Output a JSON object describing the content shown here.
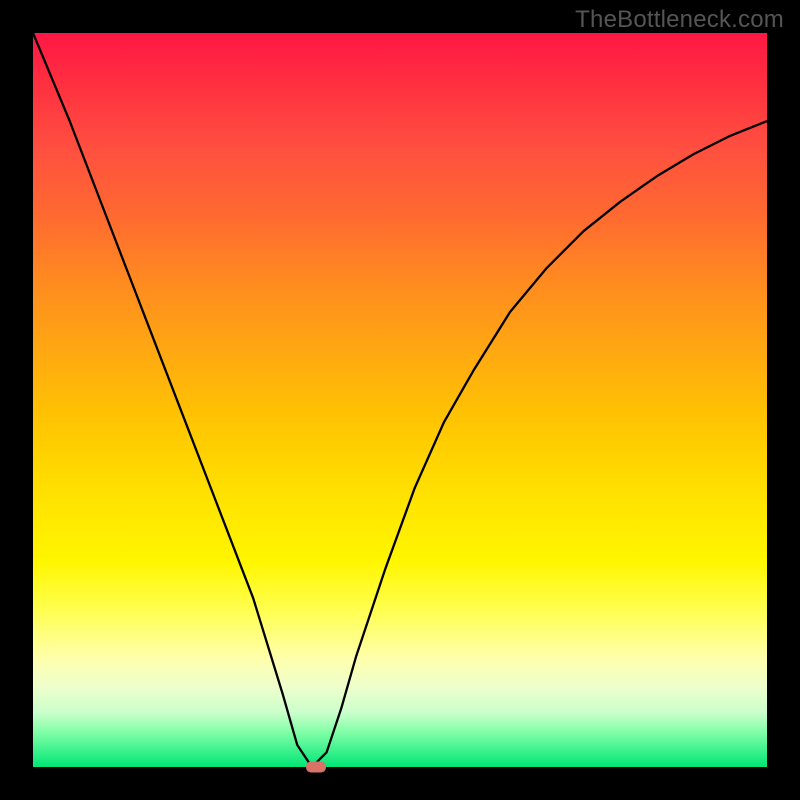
{
  "watermark": "TheBottleneck.com",
  "chart_data": {
    "type": "line",
    "title": "",
    "xlabel": "",
    "ylabel": "",
    "xlim": [
      0,
      100
    ],
    "ylim": [
      0,
      100
    ],
    "series": [
      {
        "name": "bottleneck-curve",
        "x": [
          0,
          5,
          10,
          15,
          20,
          25,
          30,
          34,
          36,
          38,
          40,
          42,
          44,
          48,
          52,
          56,
          60,
          65,
          70,
          75,
          80,
          85,
          90,
          95,
          100
        ],
        "values": [
          100,
          88,
          75,
          62,
          49,
          36,
          23,
          10,
          3,
          0,
          2,
          8,
          15,
          27,
          38,
          47,
          54,
          62,
          68,
          73,
          77,
          80.5,
          83.5,
          86,
          88
        ]
      }
    ],
    "marker": {
      "x": 38.5,
      "y": 0,
      "color": "#d9736a"
    },
    "gradient_stops": [
      {
        "pct": 0,
        "color": "#ff1744"
      },
      {
        "pct": 50,
        "color": "#ffe400"
      },
      {
        "pct": 90,
        "color": "#ffffcc"
      },
      {
        "pct": 100,
        "color": "#00e676"
      }
    ]
  }
}
